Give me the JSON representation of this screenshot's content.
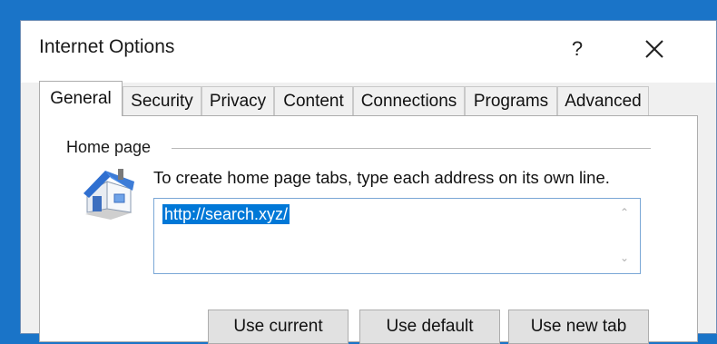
{
  "window": {
    "title": "Internet Options",
    "help_label": "?"
  },
  "tabs": [
    {
      "label": "General",
      "active": true
    },
    {
      "label": "Security",
      "active": false
    },
    {
      "label": "Privacy",
      "active": false
    },
    {
      "label": "Content",
      "active": false
    },
    {
      "label": "Connections",
      "active": false
    },
    {
      "label": "Programs",
      "active": false
    },
    {
      "label": "Advanced",
      "active": false
    }
  ],
  "home_page": {
    "group_label": "Home page",
    "icon": "house-icon",
    "description": "To create home page tabs, type each address on its own line.",
    "address_value": "http://search.xyz/",
    "buttons": {
      "use_current": "Use current",
      "use_default": "Use default",
      "use_new_tab": "Use new tab"
    }
  },
  "colors": {
    "desktop": "#1a74c8",
    "selection": "#0078d7",
    "button_face": "#e1e1e1"
  }
}
